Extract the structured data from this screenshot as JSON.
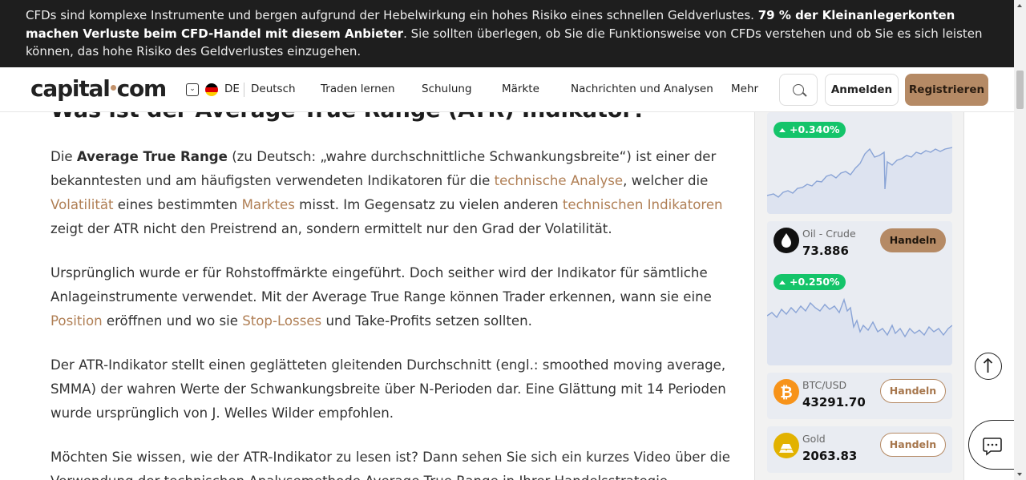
{
  "risk_banner": {
    "text_a": "CFDs sind komplexe Instrumente und bergen aufgrund der Hebelwirkung ein hohes Risiko eines schnellen Geldverlustes. ",
    "text_b": "79 % der Kleinanlegerkonten machen Verluste beim CFD-Handel mit diesem Anbieter",
    "text_c": ". Sie sollten überlegen, ob Sie die Funktionsweise von CFDs verstehen und ob Sie es sich leisten können, das hohe Risiko des Geldverlustes einzugehen."
  },
  "header": {
    "logo_left": "capital",
    "logo_right": "com",
    "lang_code": "DE",
    "lang_name": "Deutsch",
    "nav": [
      "Traden lernen",
      "Schulung",
      "Märkte",
      "Nachrichten und Analysen",
      "Mehr"
    ],
    "login_label": "Anmelden",
    "register_label": "Registrieren",
    "search_icon": "search-icon",
    "flag_colors": [
      "#000000",
      "#dd0000",
      "#ffce00"
    ]
  },
  "article": {
    "heading": "Was ist der Average True Range (ATR) Indikator?",
    "p1": {
      "t1": "Die ",
      "b1": "Average True Range",
      "t2": " (zu Deutsch: „wahre durchschnittliche Schwankungsbreite“) ist einer der bekanntesten und am häufigsten verwendeten Indikatoren für die ",
      "l1": "technische Analyse",
      "t3": ", welcher die ",
      "l2": "Volatilität",
      "t4": " eines bestimmten ",
      "l3": "Marktes",
      "t5": " misst. Im Gegensatz zu vielen anderen ",
      "l4": "technischen Indikatoren",
      "t6": " zeigt der ATR nicht den Preistrend an, sondern ermittelt nur den Grad der Volatilität."
    },
    "p2": {
      "t1": "Ursprünglich wurde er für Rohstoffmärkte eingeführt. Doch seither wird der Indikator für sämtliche Anlageinstrumente verwendet. Mit der Average True Range können Trader erkennen, wann sie eine ",
      "l1": "Position",
      "t2": " eröffnen und wo sie ",
      "l2": "Stop-Losses",
      "t3": " und Take-Profits setzen sollten."
    },
    "p3": "Der ATR-Indikator stellt einen geglätteten gleitenden Durchschnitt (engl.: smoothed moving average, SMMA) der wahren Werte der Schwankungsbreite über N-Perioden dar. Eine Glättung mit 14 Perioden wurde ursprünglich von J. Welles Wilder empfohlen.",
    "p4": "Möchten Sie wissen, wie der ATR-Indikator zu lesen ist? Dann sehen Sie sich ein kurzes Video über die Verwendung der technischen Analysemethode Average True Range in Ihrer Handelsstrategie"
  },
  "sidebar": {
    "top_card": {
      "change": "+0.340%"
    },
    "oil": {
      "name": "Oil - Crude",
      "price": "73.886",
      "change": "+0.250%",
      "trade": "Handeln"
    },
    "btc": {
      "name": "BTC/USD",
      "price": "43291.70",
      "trade": "Handeln"
    },
    "gold": {
      "name": "Gold",
      "price": "2063.83",
      "trade": "Handeln"
    },
    "colors": {
      "positive": "#14c46a",
      "accent": "#b58a65"
    }
  },
  "floating": {
    "scroll_top_icon": "arrow-up-icon",
    "chat_icon": "chat-icon"
  }
}
